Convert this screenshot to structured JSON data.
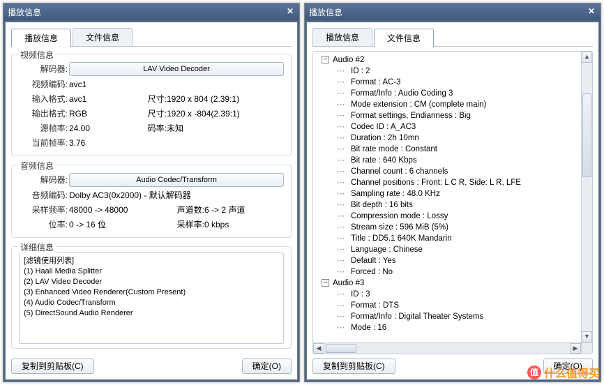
{
  "left": {
    "window_title": "播放信息",
    "tabs": {
      "play": "播放信息",
      "file": "文件信息"
    },
    "video": {
      "legend": "视频信息",
      "decoder_label": "解码器:",
      "decoder_button": "LAV Video Decoder",
      "codec_label": "视频编码:",
      "codec_value": "avc1",
      "input_label": "输入格式:",
      "input_value": "avc1",
      "size_label": "尺寸:",
      "size_in": "1920 x 804 (2.39:1)",
      "output_label": "输出格式:",
      "output_value": "RGB",
      "size_out": "1920 x -804(2.39:1)",
      "src_fps_label": "源帧率:",
      "src_fps_value": "24.00",
      "bitrate_label": "码率:",
      "bitrate_value": "未知",
      "cur_fps_label": "当前帧率:",
      "cur_fps_value": "3.76"
    },
    "audio": {
      "legend": "音频信息",
      "decoder_label": "解码器:",
      "decoder_button": "Audio Codec/Transform",
      "codec_label": "音频编码:",
      "codec_value": "Dolby AC3(0x2000) - 默认解码器",
      "sample_label": "采样频率:",
      "sample_value": "48000 -> 48000",
      "channels_label": "声道数:",
      "channels_value": "6 -> 2 声道",
      "bit_label": "位率:",
      "bit_value": "0 -> 16 位",
      "srate_label": "采样率:",
      "srate_value": "0 kbps"
    },
    "details": {
      "legend": "详细信息",
      "lines": [
        "[滤镜使用列表]",
        "(1) Haali Media Splitter",
        "(2) LAV Video Decoder",
        "(3) Enhanced Video Renderer(Custom Present)",
        "(4) Audio Codec/Transform",
        "(5) DirectSound Audio Renderer"
      ]
    },
    "footer": {
      "copy": "复制到剪贴板(C)",
      "ok": "确定(O)"
    }
  },
  "right": {
    "window_title": "播放信息",
    "tabs": {
      "play": "播放信息",
      "file": "文件信息"
    },
    "tree": {
      "audio2": {
        "header": "Audio #2",
        "items": [
          "ID : 2",
          "Format : AC-3",
          "Format/Info : Audio Coding 3",
          "Mode extension : CM (complete main)",
          "Format settings, Endianness : Big",
          "Codec ID : A_AC3",
          "Duration : 2h 10mn",
          "Bit rate mode : Constant",
          "Bit rate : 640 Kbps",
          "Channel count : 6 channels",
          "Channel positions : Front: L C R, Side: L R, LFE",
          "Sampling rate : 48.0 KHz",
          "Bit depth : 16 bits",
          "Compression mode : Lossy",
          "Stream size : 596 MiB (5%)",
          "Title : DD5.1 640K Mandarin",
          "Language : Chinese",
          "Default : Yes",
          "Forced : No"
        ]
      },
      "audio3": {
        "header": "Audio #3",
        "items": [
          "ID : 3",
          "Format : DTS",
          "Format/Info : Digital Theater Systems",
          "Mode : 16"
        ]
      }
    },
    "footer": {
      "copy": "复制到剪贴板(C)",
      "ok": "确定(O)"
    }
  },
  "watermark": {
    "logo": "值",
    "text": "什么值得买"
  }
}
